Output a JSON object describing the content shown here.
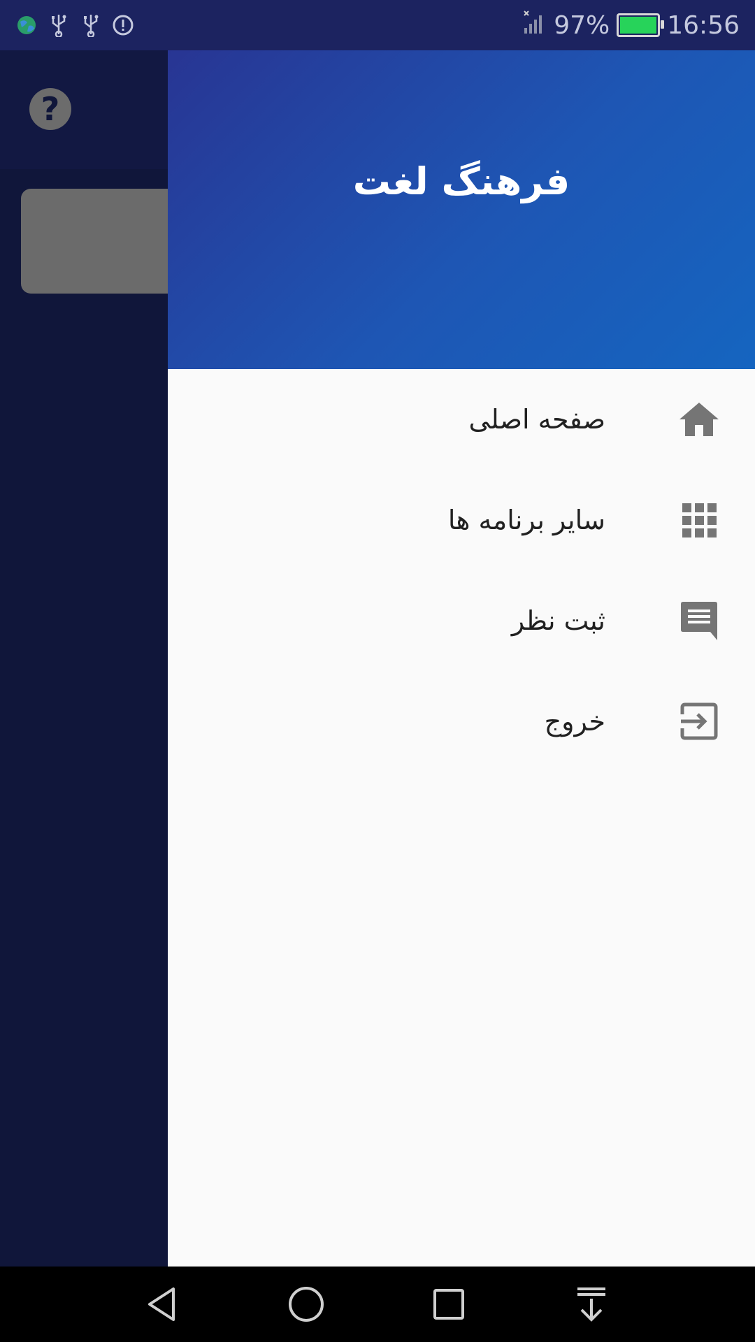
{
  "status_bar": {
    "battery_percent": "97%",
    "time": "16:56",
    "left_icons": [
      "globe-icon",
      "usb-icon",
      "usb-icon",
      "alert-icon"
    ],
    "colors": {
      "battery_fill": "#27d35a"
    }
  },
  "background_app": {
    "help_icon": "?"
  },
  "drawer": {
    "title": "فرهنگ لغت",
    "colors": {
      "header_start": "#283593",
      "header_end": "#1565c0"
    },
    "items": [
      {
        "label": "صفحه اصلی",
        "icon": "home-icon"
      },
      {
        "label": "سایر برنامه ها",
        "icon": "apps-grid-icon"
      },
      {
        "label": "ثبت نظر",
        "icon": "comment-icon"
      },
      {
        "label": "خروج",
        "icon": "exit-icon"
      }
    ]
  },
  "nav_bar": {
    "buttons": [
      "back-icon",
      "home-circle-icon",
      "recents-icon",
      "notifications-pull-icon"
    ]
  }
}
